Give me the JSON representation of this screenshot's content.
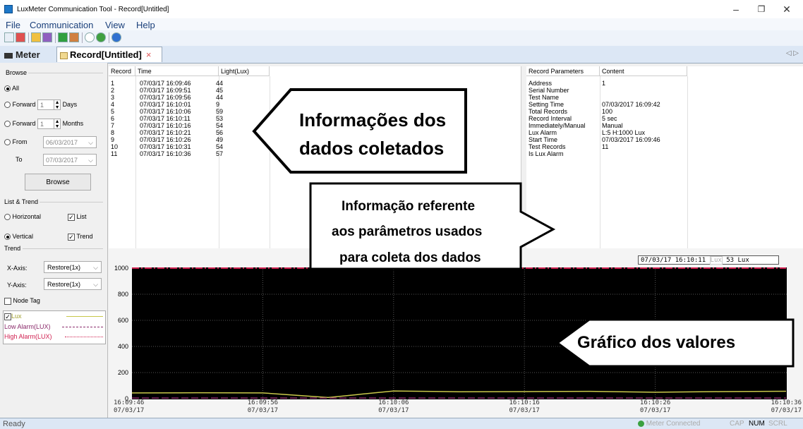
{
  "window": {
    "title": "LuxMeter Communication Tool - Record[Untitled]",
    "minimize": "–",
    "maximize": "❐",
    "close": "✕"
  },
  "menu": {
    "items": [
      "File",
      "Communication",
      "View",
      "Help"
    ]
  },
  "tabs": {
    "meter": "Meter",
    "record": "Record[Untitled]",
    "close": "×",
    "scroll": "◁ ▷"
  },
  "left_panel": {
    "browse_title": "Browse",
    "all": "All",
    "forward": "Forward",
    "forward_days_value": "1",
    "days": "Days",
    "forward_months_value": "1",
    "months": "Months",
    "from": "From",
    "from_date": "06/03/2017",
    "to": "To",
    "to_date": "07/03/2017",
    "browse_button": "Browse",
    "list_trend_title": "List & Trend",
    "horizontal": "Horizontal",
    "list": "List",
    "vertical": "Vertical",
    "trend": "Trend",
    "trend_title": "Trend",
    "x_axis": "X-Axis:",
    "x_axis_value": "Restore(1x)",
    "y_axis": "Y-Axis:",
    "y_axis_value": "Restore(1x)",
    "node_tag": "Node Tag",
    "legend": [
      {
        "label": "Lux",
        "color": "#c8c84a",
        "style": "solid"
      },
      {
        "label": "Low Alarm(LUX)",
        "color": "#8a2a6a",
        "style": "dashed"
      },
      {
        "label": "High Alarm(LUX)",
        "color": "#d02050",
        "style": "dashdot"
      }
    ]
  },
  "record_table": {
    "columns": [
      "Record",
      "Time",
      "Light(Lux)"
    ],
    "rows": [
      [
        "1",
        "07/03/17 16:09:46",
        "44"
      ],
      [
        "2",
        "07/03/17 16:09:51",
        "45"
      ],
      [
        "3",
        "07/03/17 16:09:56",
        "44"
      ],
      [
        "4",
        "07/03/17 16:10:01",
        "9"
      ],
      [
        "5",
        "07/03/17 16:10:06",
        "59"
      ],
      [
        "6",
        "07/03/17 16:10:11",
        "53"
      ],
      [
        "7",
        "07/03/17 16:10:16",
        "54"
      ],
      [
        "8",
        "07/03/17 16:10:21",
        "56"
      ],
      [
        "9",
        "07/03/17 16:10:26",
        "49"
      ],
      [
        "10",
        "07/03/17 16:10:31",
        "54"
      ],
      [
        "11",
        "07/03/17 16:10:36",
        "57"
      ]
    ]
  },
  "param_table": {
    "columns": [
      "Record Parameters",
      "Content"
    ],
    "rows": [
      [
        "Address",
        "1"
      ],
      [
        "Serial Number",
        ""
      ],
      [
        "Test Name",
        ""
      ],
      [
        "Setting Time",
        "07/03/2017 16:09:42"
      ],
      [
        "Total Records",
        "100"
      ],
      [
        "Record Interval",
        "5 sec"
      ],
      [
        "Immediately/Manual",
        "Manual"
      ],
      [
        "Lux Alarm",
        "L:5 H:1000 Lux"
      ],
      [
        "Start Time",
        "07/03/2017 16:09:46"
      ],
      [
        "Test Records",
        "11"
      ],
      [
        "Is Lux Alarm",
        ""
      ]
    ]
  },
  "chart": {
    "readout_time": "07/03/17 16:10:11",
    "readout_unit_label": "Lux",
    "readout_value": "53 Lux",
    "y_ticks": [
      "1000",
      "800",
      "600",
      "400",
      "200",
      "0"
    ],
    "x_ticks": [
      {
        "time": "16:09:46",
        "date": "07/03/17"
      },
      {
        "time": "16:09:56",
        "date": "07/03/17"
      },
      {
        "time": "16:10:06",
        "date": "07/03/17"
      },
      {
        "time": "16:10:16",
        "date": "07/03/17"
      },
      {
        "time": "16:10:26",
        "date": "07/03/17"
      },
      {
        "time": "16:10:36",
        "date": "07/03/17"
      }
    ],
    "background": "#000000",
    "line_color": "#c8c84a"
  },
  "chart_data": {
    "type": "line",
    "x": [
      "16:09:46",
      "16:09:51",
      "16:09:56",
      "16:10:01",
      "16:10:06",
      "16:10:11",
      "16:10:16",
      "16:10:21",
      "16:10:26",
      "16:10:31",
      "16:10:36"
    ],
    "series": [
      {
        "name": "Lux",
        "values": [
          44,
          45,
          44,
          9,
          59,
          53,
          54,
          56,
          49,
          54,
          57
        ]
      },
      {
        "name": "Low Alarm(LUX)",
        "values": [
          5,
          5,
          5,
          5,
          5,
          5,
          5,
          5,
          5,
          5,
          5
        ]
      },
      {
        "name": "High Alarm(LUX)",
        "values": [
          1000,
          1000,
          1000,
          1000,
          1000,
          1000,
          1000,
          1000,
          1000,
          1000,
          1000
        ]
      }
    ],
    "ylim": [
      0,
      1000
    ],
    "grid": true
  },
  "annotations": {
    "data_info_line1": "Informações dos",
    "data_info_line2": "dados coletados",
    "params_line1": "Informação referente",
    "params_line2": "aos parâmetros usados",
    "params_line3": "para coleta dos dados",
    "graph": "Gráfico dos valores"
  },
  "status": {
    "ready": "Ready",
    "connected": "Meter Connected",
    "cap": "CAP",
    "num": "NUM",
    "scrl": "SCRL"
  }
}
